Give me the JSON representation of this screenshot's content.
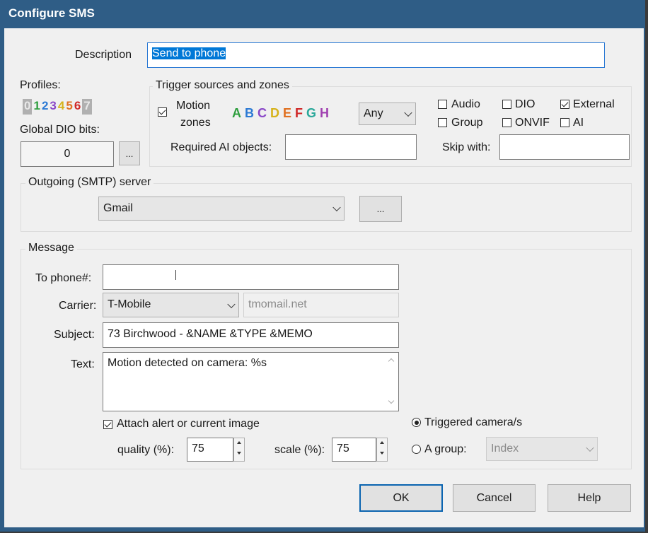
{
  "window": {
    "title": "Configure SMS"
  },
  "description": {
    "label": "Description",
    "value": "Send to phone"
  },
  "profiles": {
    "label": "Profiles:",
    "items": [
      {
        "label": "0",
        "color": "#b0b0b0"
      },
      {
        "label": "1",
        "color": "#2e9e3e"
      },
      {
        "label": "2",
        "color": "#2c7ad4"
      },
      {
        "label": "3",
        "color": "#8a48c8"
      },
      {
        "label": "4",
        "color": "#d6b21a"
      },
      {
        "label": "5",
        "color": "#e07020"
      },
      {
        "label": "6",
        "color": "#d02828"
      },
      {
        "label": "7",
        "color": "#b0b0b0"
      }
    ]
  },
  "global_dio": {
    "label": "Global DIO bits:",
    "value": "0",
    "browse_label": "..."
  },
  "trigger": {
    "title": "Trigger sources and zones",
    "motion_zones_label_line1": "Motion",
    "motion_zones_label_line2": "zones",
    "motion_zones_checked": true,
    "zones": [
      {
        "label": "A",
        "color": "#2e9e3e"
      },
      {
        "label": "B",
        "color": "#2c7ad4"
      },
      {
        "label": "C",
        "color": "#8a48c8"
      },
      {
        "label": "D",
        "color": "#d6b21a"
      },
      {
        "label": "E",
        "color": "#e07020"
      },
      {
        "label": "F",
        "color": "#d02828"
      },
      {
        "label": "G",
        "color": "#2ba89a"
      },
      {
        "label": "H",
        "color": "#a040b0"
      }
    ],
    "zone_mode": "Any",
    "audio": {
      "label": "Audio",
      "checked": false
    },
    "dio": {
      "label": "DIO",
      "checked": false
    },
    "external": {
      "label": "External",
      "checked": true
    },
    "group": {
      "label": "Group",
      "checked": false
    },
    "onvif": {
      "label": "ONVIF",
      "checked": false
    },
    "ai": {
      "label": "AI",
      "checked": false
    },
    "required_ai_label": "Required AI objects:",
    "required_ai_value": "",
    "skip_with_label": "Skip with:",
    "skip_with_value": ""
  },
  "smtp": {
    "title": "Outgoing (SMTP) server",
    "server": "Gmail",
    "browse_label": "..."
  },
  "message": {
    "title": "Message",
    "to_label": "To phone#:",
    "to_value": "",
    "carrier_label": "Carrier:",
    "carrier_value": "T-Mobile",
    "carrier_domain": "tmomail.net",
    "subject_label": "Subject:",
    "subject_value": "73 Birchwood - &NAME &TYPE &MEMO",
    "text_label": "Text:",
    "text_value": "Motion detected on camera: %s",
    "attach_label": "Attach alert or current image",
    "attach_checked": true,
    "quality_label": "quality (%):",
    "quality_value": "75",
    "scale_label": "scale (%):",
    "scale_value": "75",
    "triggered_label": "Triggered camera/s",
    "triggered_selected": true,
    "agroup_label": "A group:",
    "agroup_value": "Index"
  },
  "buttons": {
    "ok": "OK",
    "cancel": "Cancel",
    "help": "Help"
  }
}
